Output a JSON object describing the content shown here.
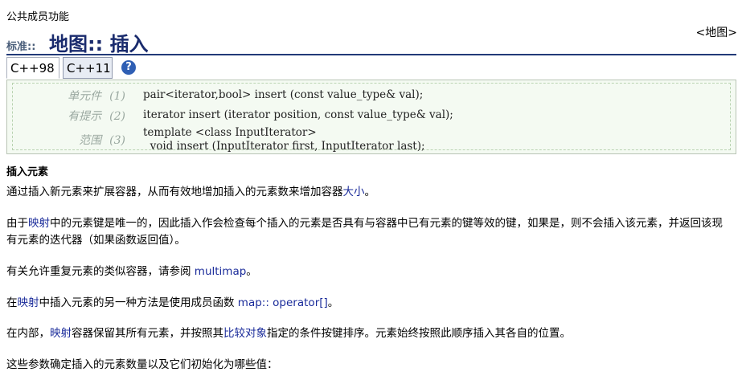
{
  "context_label": "公共成员功能",
  "title": {
    "prefix": "标准::",
    "namespace": "地图",
    "separator": "::",
    "name": "插入"
  },
  "breadcrumb": {
    "open": "<",
    "link": "地图",
    "close": ">"
  },
  "tabs": [
    "C++98",
    "C++11"
  ],
  "help_icon_glyph": "?",
  "prototypes": [
    {
      "label": "单元件",
      "num": "(1)",
      "code": "pair<iterator,bool> insert (const value_type& val);"
    },
    {
      "label": "有提示",
      "num": "(2)",
      "code": "iterator insert (iterator position, const value_type& val);"
    },
    {
      "label": "范围",
      "num": "(3)",
      "code_lines": [
        "template <class InputIterator>",
        "  void insert (InputIterator first, InputIterator last);"
      ]
    }
  ],
  "section_heading": "插入元素",
  "paragraphs": {
    "p1": {
      "a": "通过插入新元素来扩展容器，从而有效地增加插入的元素数来增加容器",
      "link": "大小",
      "b": "。"
    },
    "p2": {
      "a": "由于",
      "link": "映射",
      "b": "中的元素键是唯一的，因此插入作会检查每个插入的元素是否具有与容器中已有元素的键等效的键，如果是，则不会插入该元素，并返回该现有元素的迭代器（如果函数返回值）。"
    },
    "p3": {
      "a": "有关允许重复元素的类似容器，请参阅 ",
      "link": "multimap",
      "b": "。"
    },
    "p4": {
      "a": "在",
      "link1": "映射",
      "b": "中插入元素的另一种方法是使用成员函数 ",
      "link2": "map:: operator[]",
      "c": "。"
    },
    "p5": {
      "a": "在内部，",
      "link1": "映射",
      "b": "容器保留其所有元素，并按照其",
      "link2": "比较对象",
      "c": "指定的条件按键排序。元素始终按照此顺序插入其各自的位置。"
    },
    "p6": {
      "a": "这些参数确定插入的元素数量以及它们初始化为哪些值："
    }
  }
}
